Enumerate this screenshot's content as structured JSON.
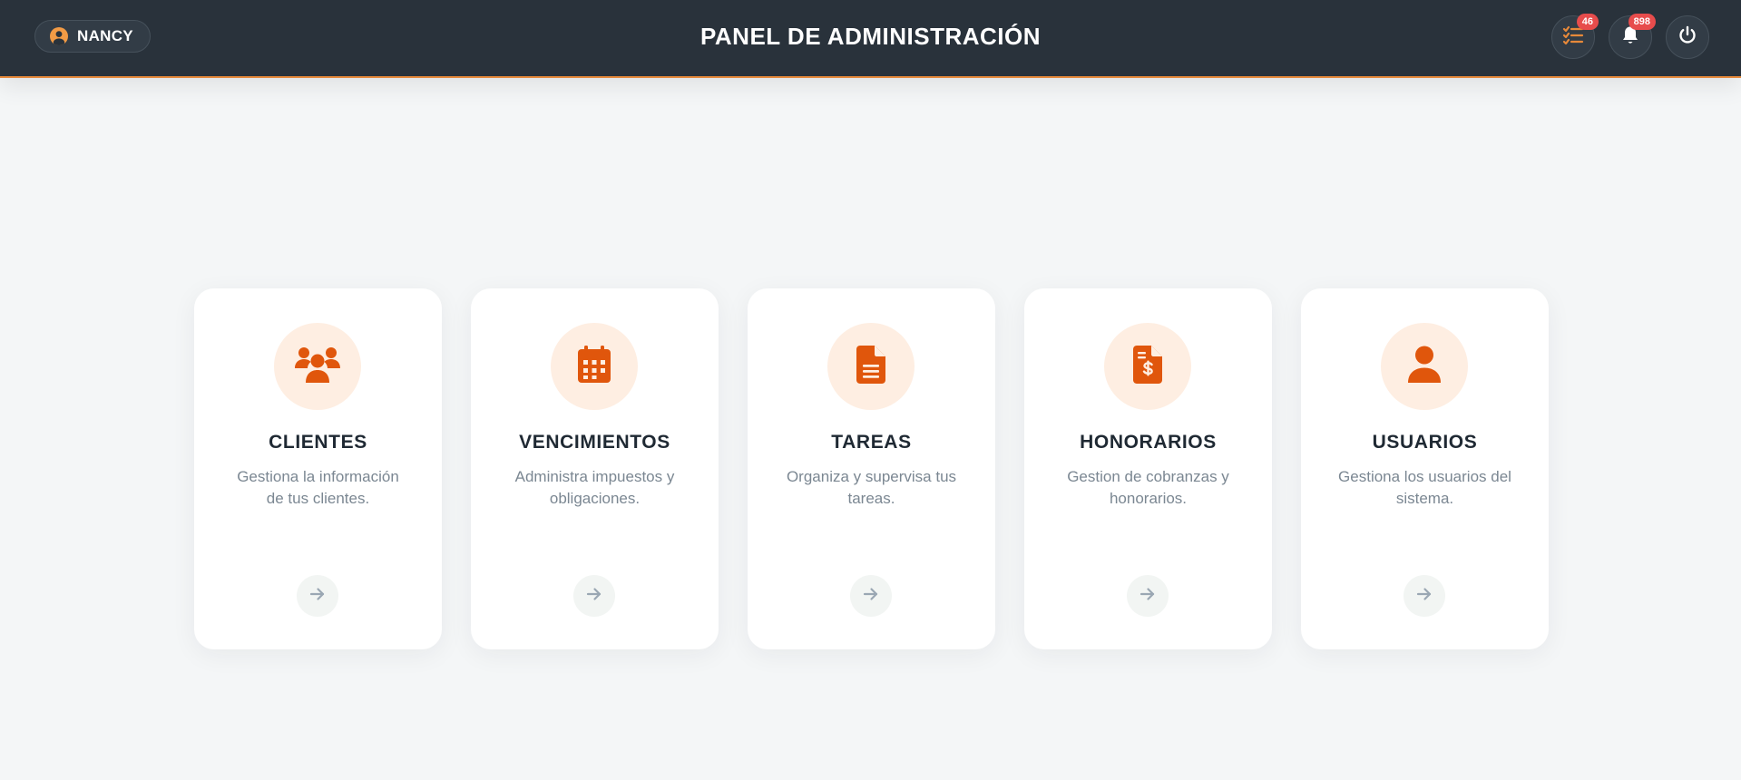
{
  "header": {
    "user_name": "NANCY",
    "title": "PANEL DE ADMINISTRACIÓN",
    "tasks_badge": "46",
    "notifications_badge": "898"
  },
  "icons": {
    "user": "user-circle-icon",
    "tasks": "checklist-icon",
    "notifications": "bell-icon",
    "logout": "power-icon"
  },
  "colors": {
    "header_bg": "#29323b",
    "accent": "#e7893a",
    "icon_orange": "#e0560c",
    "icon_bg": "#feeee2",
    "badge": "#e74c4c"
  },
  "cards": [
    {
      "title": "CLIENTES",
      "description": "Gestiona la información de tus clientes.",
      "icon": "users-icon"
    },
    {
      "title": "VENCIMIENTOS",
      "description": "Administra impuestos y obligaciones.",
      "icon": "calendar-icon"
    },
    {
      "title": "TAREAS",
      "description": "Organiza y supervisa tus tareas.",
      "icon": "document-icon"
    },
    {
      "title": "HONORARIOS",
      "description": "Gestion de cobranzas y honorarios.",
      "icon": "invoice-dollar-icon"
    },
    {
      "title": "USUARIOS",
      "description": "Gestiona los usuarios del sistema.",
      "icon": "user-icon"
    }
  ]
}
